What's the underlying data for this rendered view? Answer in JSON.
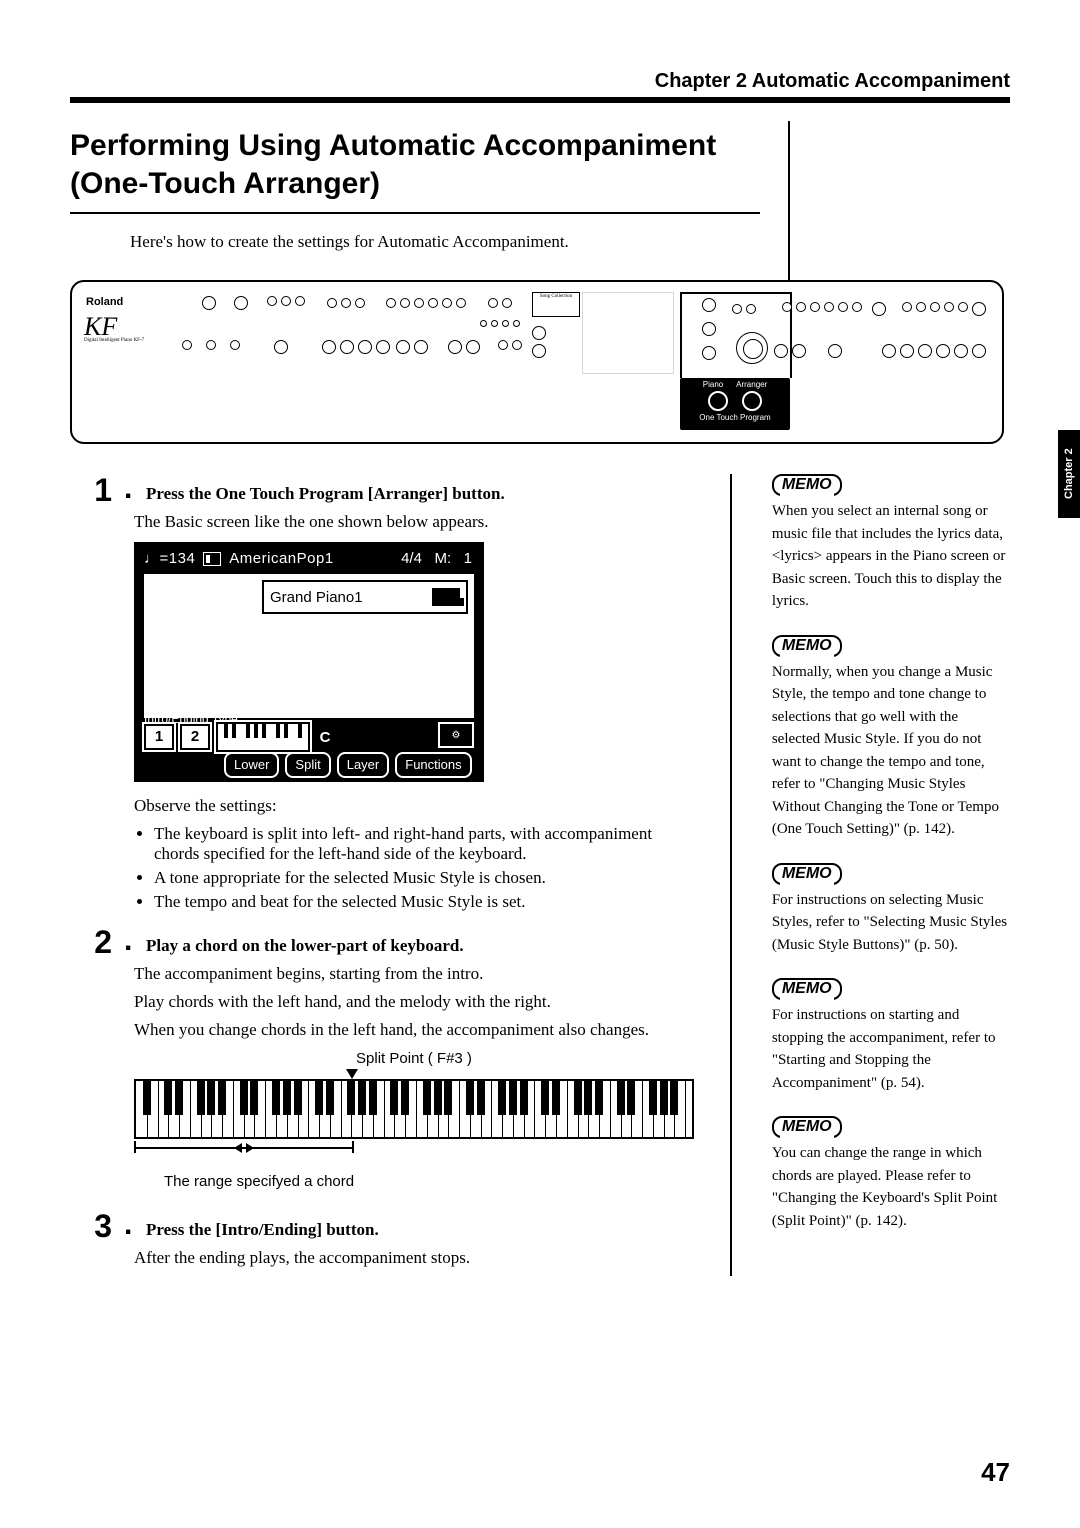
{
  "chapterHead": "Chapter 2 Automatic Accompaniment",
  "mainTitle": "Performing Using Automatic Accompaniment (One-Touch Arranger)",
  "intro": "Here's how to create the settings for Automatic Accompaniment.",
  "panel": {
    "brand": "Roland",
    "model": "KF",
    "sub": "Digital Intelligent Piano KF-7",
    "songCollection": "Song Collection",
    "oneTouch": {
      "piano": "Piano",
      "arranger": "Arranger",
      "label": "One Touch Program"
    }
  },
  "steps": {
    "s1": {
      "num": "1",
      "head": "Press the One Touch Program [Arranger] button.",
      "body1": "The Basic screen like the one shown below appears.",
      "observe": "Observe the settings:",
      "bul1": "The keyboard is split into left- and right-hand parts, with accompaniment chords specified for the left-hand side of the keyboard.",
      "bul2": "A tone appropriate for the selected Music Style is chosen.",
      "bul3": "The tempo and beat for the selected Music Style is set."
    },
    "s2": {
      "num": "2",
      "head": "Play a chord on the lower-part of keyboard.",
      "body1": "The accompaniment begins, starting from the intro.",
      "body2": "Play chords with the left hand, and the melody with the right.",
      "body3": "When you change chords in the left hand, the accompaniment also changes."
    },
    "s3": {
      "num": "3",
      "head": "Press the [Intro/Ending] button.",
      "body1": "After the ending plays, the accompaniment stops."
    }
  },
  "screen": {
    "tempo": "♩=134",
    "style": "AmericanPop1",
    "beat": "4/4",
    "measureLabel": "M:",
    "measure": "1",
    "tone": "Grand Piano1",
    "introLabel": "Intro/Ending Type",
    "btn1": "1",
    "btn2": "2",
    "note": "C",
    "lower": "Lower",
    "split": "Split",
    "layer": "Layer",
    "functions": "Functions"
  },
  "kbd": {
    "topLabel": "Split Point ( F#3 )",
    "botLabel": "The range specifyed a chord"
  },
  "memos": {
    "label": "MEMO",
    "m1": "When you select an internal song or music file that includes the lyrics data, <lyrics> appears in the Piano screen or Basic screen. Touch this to display the lyrics.",
    "m2": "Normally, when you change a Music Style, the tempo and tone change to selections that go well with the selected Music Style. If you do not want to change the tempo and tone, refer to \"Changing Music Styles Without Changing the Tone or Tempo (One Touch Setting)\" (p. 142).",
    "m3": "For instructions on selecting Music Styles, refer to \"Selecting Music Styles (Music Style Buttons)\" (p. 50).",
    "m4": "For instructions on starting and stopping the accompaniment, refer to \"Starting and Stopping the Accompaniment\" (p. 54).",
    "m5": "You can change the range in which chords are played. Please refer to \"Changing the Keyboard's Split Point (Split Point)\" (p. 142)."
  },
  "sideTab": "Chapter 2",
  "pageNumber": "47"
}
